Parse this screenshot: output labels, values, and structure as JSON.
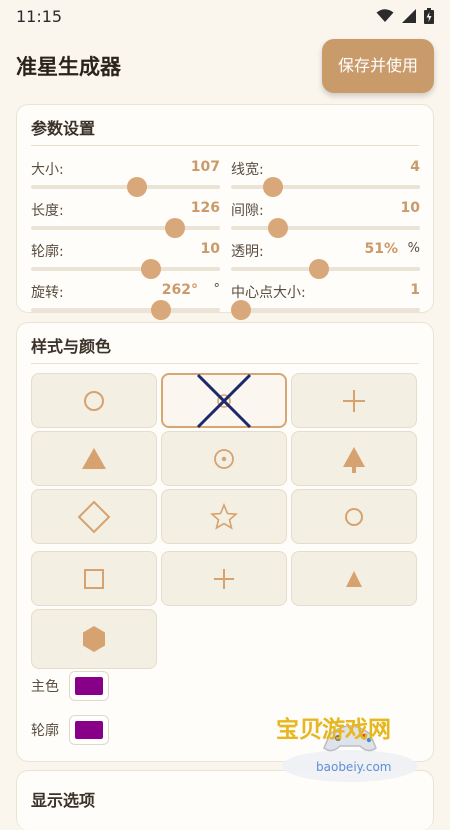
{
  "status": {
    "time": "11:15"
  },
  "appbar": {
    "title": "准星生成器",
    "save_label": "保存并使用"
  },
  "params": {
    "title": "参数设置",
    "items": [
      {
        "label": "大小:",
        "value": "107",
        "unit": "",
        "fraction": 0.57
      },
      {
        "label": "线宽:",
        "value": "4",
        "unit": "",
        "fraction": 0.19
      },
      {
        "label": "长度:",
        "value": "126",
        "unit": "",
        "fraction": 0.79
      },
      {
        "label": "间隙:",
        "value": "10",
        "unit": "",
        "fraction": 0.22
      },
      {
        "label": "轮廓:",
        "value": "10",
        "unit": "",
        "fraction": 0.65
      },
      {
        "label": "透明:",
        "value": "51%",
        "unit": "%",
        "fraction": 0.46
      },
      {
        "label": "旋转:",
        "value": "262°",
        "unit": "°",
        "fraction": 0.71
      },
      {
        "label": "中心点大小:",
        "value": "1",
        "unit": "",
        "fraction": 0.0
      }
    ]
  },
  "styles": {
    "title": "样式与颜色",
    "cells": [
      {
        "icon": "circle-icon",
        "selected": false
      },
      {
        "icon": "x-cross-dot-icon",
        "selected": true
      },
      {
        "icon": "plus-icon",
        "selected": false
      },
      {
        "icon": "triangle-filled-icon",
        "selected": false
      },
      {
        "icon": "dotted-circle-icon",
        "selected": false
      },
      {
        "icon": "arrow-up-filled-icon",
        "selected": false
      },
      {
        "icon": "diamond-icon",
        "selected": false
      },
      {
        "icon": "star-outline-icon",
        "selected": false
      },
      {
        "icon": "circle-small-icon",
        "selected": false
      },
      {
        "icon": "square-icon",
        "selected": false
      },
      {
        "icon": "plus-small-icon",
        "selected": false
      },
      {
        "icon": "triangle-small-icon",
        "selected": false
      },
      {
        "icon": "hexagon-filled-icon",
        "selected": false
      }
    ],
    "main_color_label": "主色",
    "outline_color_label": "轮廓",
    "main_color": "#880088",
    "outline_color": "#880088"
  },
  "display": {
    "title": "显示选项"
  },
  "watermark": {
    "text_cn": "宝贝游戏网",
    "text_url": "baobeiy.com"
  },
  "colors": {
    "accent": "#c99a6a",
    "thumb": "#d9a87a",
    "icon": "#d6a26f",
    "selected_icon": "#1b2a6b"
  }
}
